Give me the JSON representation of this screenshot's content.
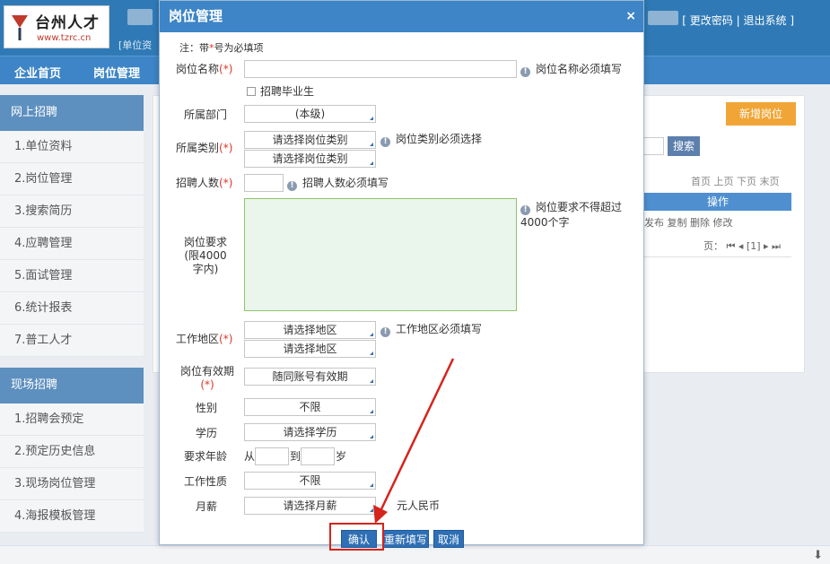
{
  "header": {
    "logo_text": "台州人才",
    "logo_url": "www.tzrc.cn",
    "unit_tag": "[单位资",
    "change_password": "更改密码",
    "logout": "退出系统"
  },
  "nav": [
    "企业首页",
    "岗位管理"
  ],
  "sidebar": {
    "online_title": "网上招聘",
    "online_items": [
      "1.单位资料",
      "2.岗位管理",
      "3.搜索简历",
      "4.应聘管理",
      "5.面试管理",
      "6.统计报表",
      "7.普工人才"
    ],
    "onsite_title": "现场招聘",
    "onsite_items": [
      "1.招聘会预定",
      "2.预定历史信息",
      "3.现场岗位管理",
      "4.海报模板管理"
    ]
  },
  "main": {
    "new_position": "新增岗位",
    "search": "搜索",
    "pager_top": "首页 上页 下页 末页",
    "operation_header": "操作",
    "operation_row": "发布 复制 删除 修改",
    "page_label": "页：",
    "page_current": "[1]"
  },
  "modal": {
    "title": "岗位管理",
    "close": "×",
    "note_prefix": "注：带",
    "note_star": "*",
    "note_suffix": "号为必填项",
    "star": "(*)",
    "position_name_label": "岗位名称",
    "position_name_hint": "岗位名称必须填写",
    "graduate_label": "招聘毕业生",
    "department_label": "所属部门",
    "department_value": "(本级)",
    "category_label": "所属类别",
    "category_select": "请选择岗位类别",
    "category_hint": "岗位类别必须选择",
    "headcount_label": "招聘人数",
    "headcount_hint": "招聘人数必须填写",
    "requirement_label": "岗位要求(限4000字内)",
    "requirement_hint": "岗位要求不得超过4000个字",
    "area_label": "工作地区",
    "area_select": "请选择地区",
    "area_hint": "工作地区必须填写",
    "validity_label": "岗位有效期",
    "validity_value": "随同账号有效期",
    "gender_label": "性别",
    "gender_value": "不限",
    "education_label": "学历",
    "education_value": "请选择学历",
    "age_label": "要求年龄",
    "age_from": "从",
    "age_to": "到",
    "age_unit": "岁",
    "nature_label": "工作性质",
    "nature_value": "不限",
    "salary_label": "月薪",
    "salary_value": "请选择月薪",
    "salary_unit": "元人民币",
    "confirm": "确认",
    "reset": "重新填写",
    "cancel": "取消"
  },
  "colors": {
    "header_blue": "#2f7ab6",
    "accent_orange": "#f0a536",
    "annotation_red": "#d4241c"
  }
}
